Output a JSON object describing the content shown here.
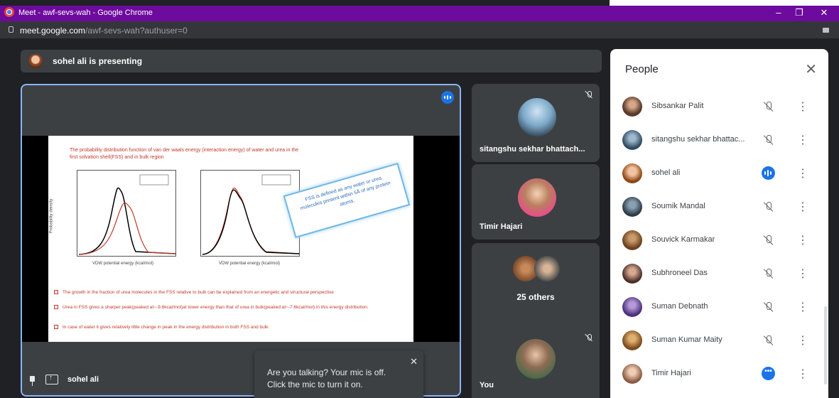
{
  "browser": {
    "window_title": "Meet - awf-sevs-wah - Google Chrome",
    "url_host": "meet.google.com",
    "url_path": "/awf-sevs-wah?authuser=0",
    "minimize": "–",
    "maximize": "❐",
    "close": "✕"
  },
  "presenting_bar": {
    "text": "sohel ali is presenting"
  },
  "slide": {
    "title": "The probability distribution function of van der waals energy (interaction energy) of water and urea in the first solvation shell(FSS) and in bulk region",
    "left_xlabel": "VDW potential energy (kcal/mol)",
    "right_xlabel": "VDW potential energy (kcal/mol)",
    "ylabel": "Probability density",
    "callout": "FSS is defined as any water or urea molecules present within 5Å of any protein atoms.",
    "bullets": [
      "The growth in the fraction of urea molecules in the FSS relative to bulk can be explained from an energetic and structural perspective",
      "Urea in FSS gives a sharper peak(peaked at~-9.6kcal/mol)at lower energy than that of urea in bulk(peaked at~-7.6kcal/mol) in this energy distribution.",
      "In case of water it gives relatively little change in peak in the energy distribution in both FSS and bulk."
    ]
  },
  "stage": {
    "presenter_name": "sohel ali"
  },
  "tiles": [
    {
      "name": "sitangshu sekhar bhattach..."
    },
    {
      "name": "Timir Hajari"
    },
    {
      "name": "25 others"
    },
    {
      "name": "You"
    }
  ],
  "toast": {
    "message": "Are you talking? Your mic is off. Click the mic to turn it on.",
    "close": "✕"
  },
  "people_panel": {
    "title": "People",
    "close": "✕",
    "participants": [
      {
        "name": "Sibsankar Palit",
        "status": "muted"
      },
      {
        "name": "sitangshu sekhar bhattac...",
        "status": "muted"
      },
      {
        "name": "sohel ali",
        "status": "speaking"
      },
      {
        "name": "Soumik Mandal",
        "status": "muted"
      },
      {
        "name": "Souvick Karmakar",
        "status": "muted"
      },
      {
        "name": "Subhroneel Das",
        "status": "muted"
      },
      {
        "name": "Suman Debnath",
        "status": "muted"
      },
      {
        "name": "Suman Kumar Maity",
        "status": "muted"
      },
      {
        "name": "Timir Hajari",
        "status": "active"
      }
    ]
  },
  "colors": {
    "accent": "#1a73e8",
    "titlebar": "#6d0b9e",
    "background": "#202124",
    "tile": "#3c4043"
  }
}
